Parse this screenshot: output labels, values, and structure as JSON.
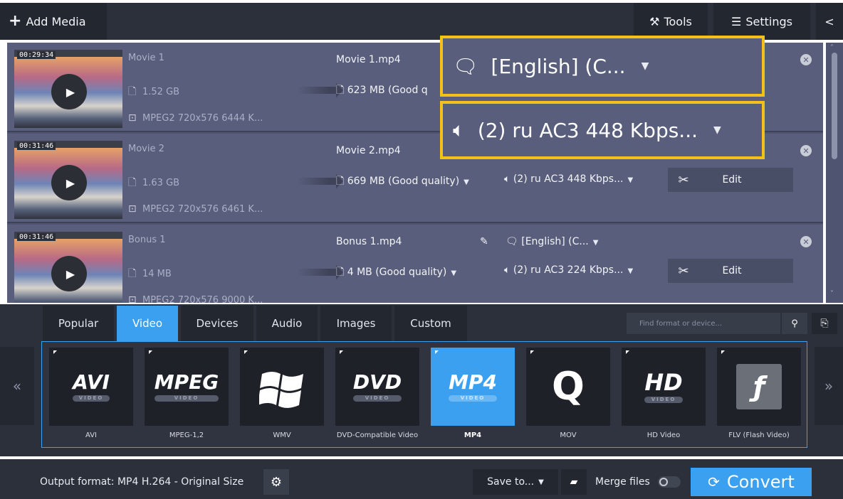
{
  "toolbar": {
    "add_media": "Add Media",
    "tools": "Tools",
    "settings": "Settings"
  },
  "files": [
    {
      "duration": "00:29:34",
      "name": "Movie 1",
      "size": "1.52 GB",
      "format": "MPEG2 720x576 6444 K...",
      "output_name": "Movie 1.mp4",
      "output_size": "623 MB (Good q"
    },
    {
      "duration": "00:31:46",
      "name": "Movie 2",
      "size": "1.63 GB",
      "format": "MPEG2 720x576 6461 K...",
      "output_name": "Movie 2.mp4",
      "output_size": "669 MB (Good quality)",
      "audio": "(2) ru AC3 448 Kbps...",
      "edit": "Edit"
    },
    {
      "duration": "00:31:46",
      "name": "Bonus 1",
      "size": "14 MB",
      "format": "MPEG2 720x576 9000 K...",
      "output_name": "Bonus 1.mp4",
      "output_size": "4 MB (Good quality)",
      "subtitles": "[English] (C...",
      "audio": "(2) ru AC3 224 Kbps...",
      "edit": "Edit"
    }
  ],
  "callouts": {
    "subtitles": "[English] (C...",
    "audio": "(2) ru AC3 448 Kbps..."
  },
  "format_tabs": [
    "Popular",
    "Video",
    "Devices",
    "Audio",
    "Images",
    "Custom"
  ],
  "active_tab": "Video",
  "search": {
    "placeholder": "Find format or device..."
  },
  "formats": [
    {
      "logo": "AVI",
      "sub": "VIDEO",
      "label": "AVI"
    },
    {
      "logo": "MPEG",
      "sub": "VIDEO",
      "label": "MPEG-1,2"
    },
    {
      "logo": "",
      "sub": "",
      "label": "WMV"
    },
    {
      "logo": "DVD",
      "sub": "VIDEO",
      "label": "DVD-Compatible Video"
    },
    {
      "logo": "MP4",
      "sub": "VIDEO",
      "label": "MP4"
    },
    {
      "logo": "Q",
      "sub": "",
      "label": "MOV"
    },
    {
      "logo": "HD",
      "sub": "VIDEO",
      "label": "HD Video"
    },
    {
      "logo": "ƒ",
      "sub": "",
      "label": "FLV (Flash Video)"
    }
  ],
  "active_format": "MP4",
  "bottom": {
    "output_format": "Output format: MP4 H.264 - Original Size",
    "save_to": "Save to...",
    "merge": "Merge files",
    "convert": "Convert"
  },
  "colors": {
    "accent": "#3ca0f0",
    "highlight_border": "#f5c01a"
  }
}
